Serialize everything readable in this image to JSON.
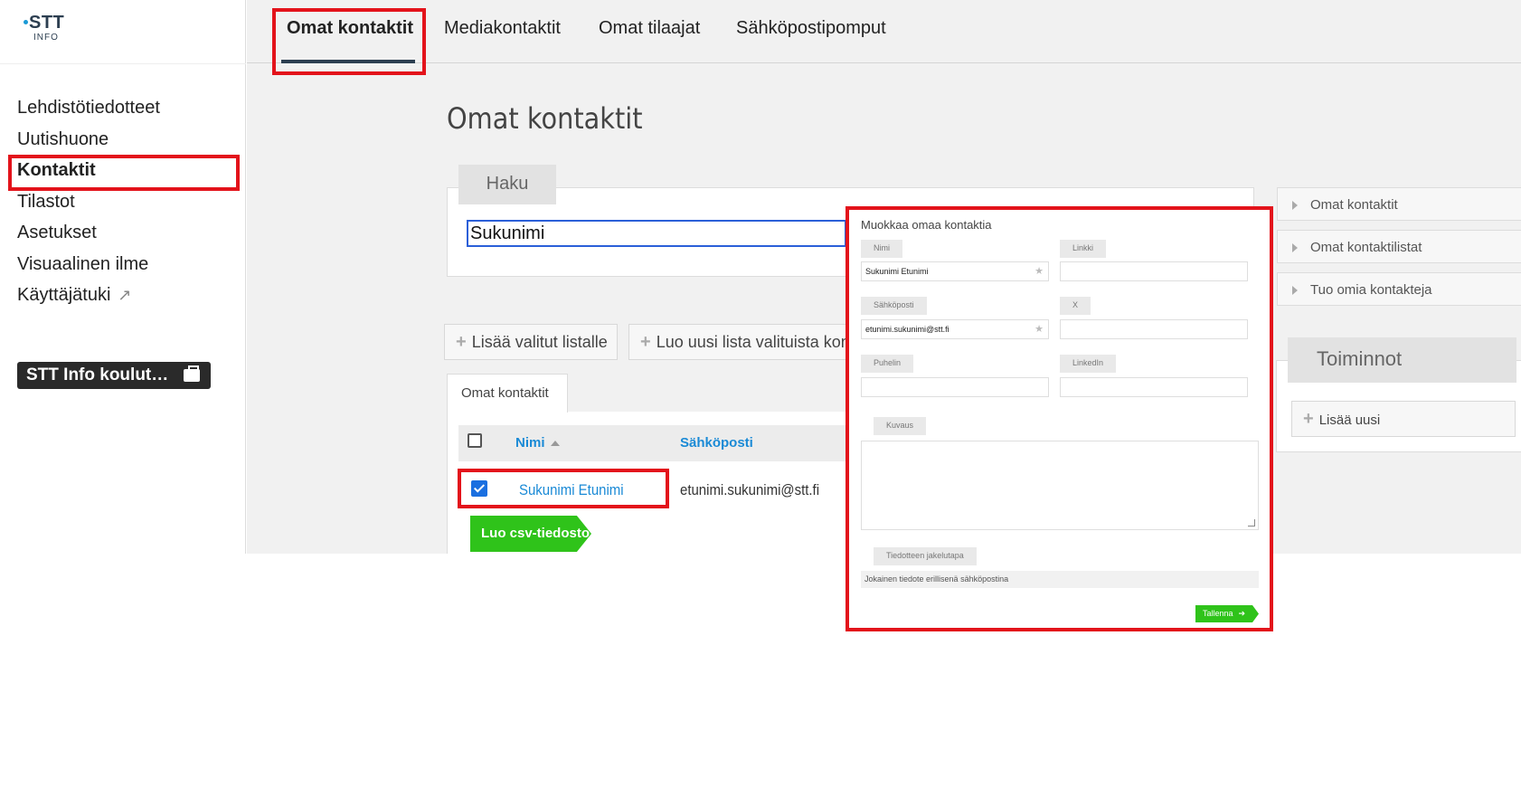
{
  "logo": {
    "brand": "STT",
    "sub": "INFO"
  },
  "sidebar": {
    "items": [
      {
        "label": "Lehdistötiedotteet"
      },
      {
        "label": "Uutishuone"
      },
      {
        "label": "Kontaktit"
      },
      {
        "label": "Tilastot"
      },
      {
        "label": "Asetukset"
      },
      {
        "label": "Visuaalinen ilme"
      },
      {
        "label": "Käyttäjätuki"
      }
    ],
    "training_label": "STT Info koulut…"
  },
  "tabs": [
    {
      "label": "Omat kontaktit"
    },
    {
      "label": "Mediakontaktit"
    },
    {
      "label": "Omat tilaajat"
    },
    {
      "label": "Sähköpostipomput"
    }
  ],
  "page_title": "Omat kontaktit",
  "search": {
    "tab_label": "Haku",
    "value": "Sukunimi"
  },
  "actions": {
    "add_selected": "Lisää valitut listalle",
    "create_list": "Luo uusi lista valituista kontakteista"
  },
  "list": {
    "tab_label": "Omat kontaktit",
    "columns": {
      "name": "Nimi",
      "email": "Sähköposti"
    },
    "rows": [
      {
        "name": "Sukunimi Etunimi",
        "email": "etunimi.sukunimi@stt.fi"
      }
    ],
    "csv_button": "Luo csv-tiedosto"
  },
  "right_panel": {
    "links": [
      {
        "label": "Omat kontaktit"
      },
      {
        "label": "Omat kontaktilistat"
      },
      {
        "label": "Tuo omia kontakteja"
      }
    ],
    "actions_title": "Toiminnot",
    "add_new": "Lisää uusi"
  },
  "edit_form": {
    "title": "Muokkaa omaa kontaktia",
    "name_label": "Nimi",
    "name_value": "Sukunimi Etunimi",
    "link_label": "Linkki",
    "email_label": "Sähköposti",
    "email_value": "etunimi.sukunimi@stt.fi",
    "x_label": "X",
    "phone_label": "Puhelin",
    "linkedin_label": "LinkedIn",
    "description_label": "Kuvaus",
    "distribution_label": "Tiedotteen jakelutapa",
    "distribution_value": "Jokainen tiedote erillisenä sähköpostina",
    "save_label": "Tallenna"
  }
}
